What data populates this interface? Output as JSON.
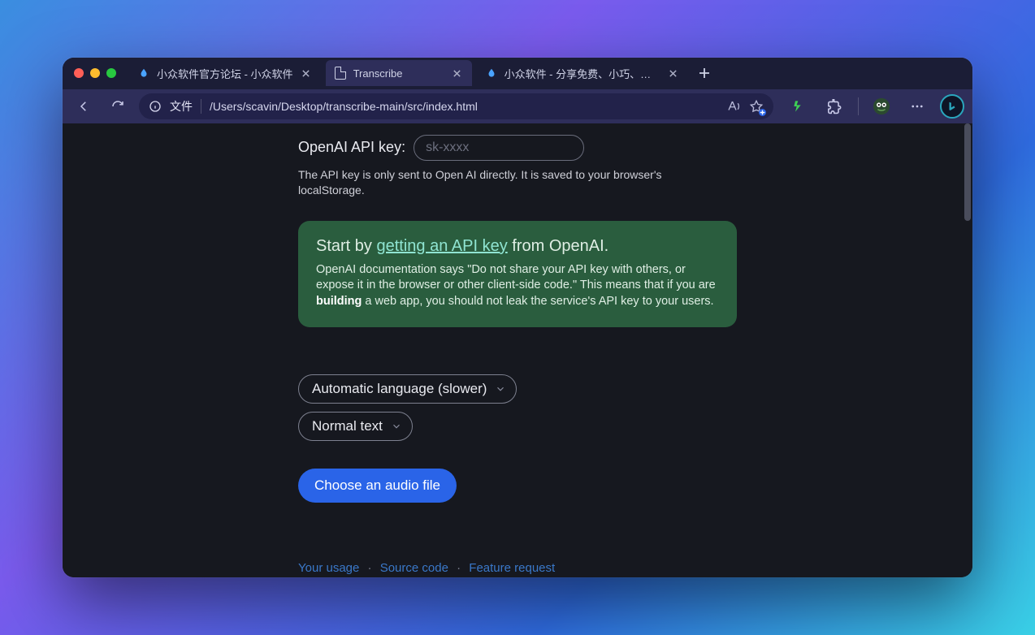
{
  "tabs": [
    {
      "title": "小众软件官方论坛 - 小众软件",
      "active": false,
      "favicon": "drop"
    },
    {
      "title": "Transcribe",
      "active": true,
      "favicon": "page"
    },
    {
      "title": "小众软件 - 分享免费、小巧、实用",
      "active": false,
      "favicon": "drop"
    }
  ],
  "addressbar": {
    "scheme_label": "文件",
    "url": "/Users/scavin/Desktop/transcribe-main/src/index.html"
  },
  "page": {
    "apikey_label": "OpenAI API key:",
    "apikey_placeholder": "sk-xxxx",
    "apikey_help": "The API key is only sent to Open AI directly. It is saved to your browser's localStorage.",
    "card": {
      "start_prefix": "Start by ",
      "start_link": "getting an API key",
      "start_suffix": " from OpenAI.",
      "body_prefix": "OpenAI documentation says \"Do not share your API key with others, or expose it in the browser or other client-side code.\" This means that if you are ",
      "body_bold": "building",
      "body_suffix": " a web app, you should not leak the service's API key to your users."
    },
    "language_select": "Automatic language (slower)",
    "format_select": "Normal text",
    "choose_button": "Choose an audio file",
    "footer": {
      "usage": "Your usage",
      "source": "Source code",
      "feature": "Feature request"
    }
  }
}
